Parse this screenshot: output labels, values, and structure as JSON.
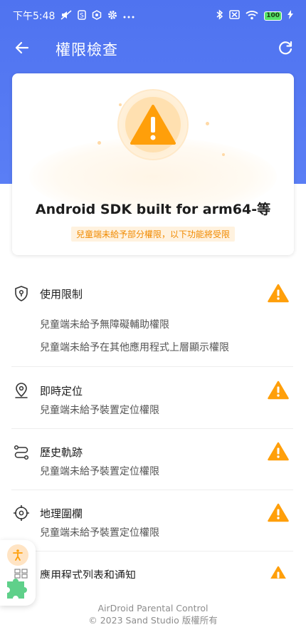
{
  "status_bar": {
    "time": "下午5:48",
    "left_icons": [
      "mute-icon",
      "s-icon",
      "vpn-icon",
      "gear-icon",
      "more-dots-icon"
    ],
    "right_icons": [
      "bluetooth-icon",
      "no-sim-icon",
      "wifi-icon",
      "battery-icon",
      "charging-icon"
    ],
    "battery": "100"
  },
  "app_bar": {
    "title": "權限檢查"
  },
  "device_card": {
    "name": "Android SDK built for arm64-等",
    "warning": "兒童端未給予部分權限，以下功能將受限"
  },
  "items": [
    {
      "title": "使用限制",
      "icon": "shield-pin-icon",
      "descriptions": [
        "兒童端未給予無障礙輔助權限",
        "兒童端未給予在其他應用程式上層顯示權限"
      ]
    },
    {
      "title": "即時定位",
      "icon": "location-pin-icon",
      "descriptions": [
        "兒童端未給予裝置定位權限"
      ]
    },
    {
      "title": "歷史軌跡",
      "icon": "route-icon",
      "descriptions": [
        "兒童端未給予裝置定位權限"
      ]
    },
    {
      "title": "地理圍欄",
      "icon": "crosshair-icon",
      "descriptions": [
        "兒童端未給予裝置定位權限"
      ]
    },
    {
      "title": "應用程式列表和通知",
      "icon": "apps-grid-icon",
      "descriptions": []
    }
  ],
  "footer": {
    "line1": "AirDroid Parental Control",
    "line2": "© 2023 Sand Studio 版權所有"
  },
  "colors": {
    "header_blue": "#4f73f0",
    "warning_orange": "#ff9f0a",
    "tag_text": "#f08a00"
  }
}
